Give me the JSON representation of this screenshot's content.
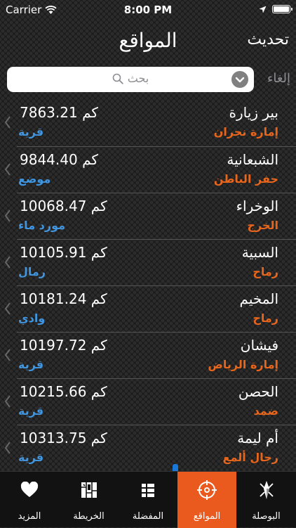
{
  "status": {
    "carrier": "Carrier",
    "time": "8:00 PM"
  },
  "nav": {
    "title": "المواقع",
    "refresh_label": "تحديث"
  },
  "search": {
    "placeholder": "بحث",
    "cancel_label": "إلغاء"
  },
  "unit": "كم",
  "rows": [
    {
      "name": "بير زيارة",
      "region": "إمارة نجران",
      "distance": "7863.21",
      "type": "قرية"
    },
    {
      "name": "الشبعانية",
      "region": "حفر الباطن",
      "distance": "9844.40",
      "type": "موضع"
    },
    {
      "name": "الوخراء",
      "region": "الخرج",
      "distance": "10068.47",
      "type": "مورد ماء"
    },
    {
      "name": "السبية",
      "region": "رماح",
      "distance": "10105.91",
      "type": "رمال"
    },
    {
      "name": "المخيم",
      "region": "رماح",
      "distance": "10181.24",
      "type": "وادي"
    },
    {
      "name": "فيشان",
      "region": "إمارة الرياض",
      "distance": "10197.72",
      "type": "قرية"
    },
    {
      "name": "الحصن",
      "region": "ضمد",
      "distance": "10215.66",
      "type": "قرية"
    },
    {
      "name": "أم ليمة",
      "region": "رجال ألمع",
      "distance": "10313.75",
      "type": "قرية"
    }
  ],
  "tabs": [
    {
      "label": "المزيد",
      "icon": "heart-icon"
    },
    {
      "label": "الخريطة",
      "icon": "map-icon"
    },
    {
      "label": "المفضلة",
      "icon": "list-icon"
    },
    {
      "label": "المواقع",
      "icon": "crosshair-icon",
      "active": true
    },
    {
      "label": "البوصلة",
      "icon": "compass-icon"
    }
  ],
  "colors": {
    "accent": "#ea5a1e",
    "region_text": "#e8661c",
    "type_text": "#3f95e0",
    "tabbar_bg": "#121212"
  }
}
